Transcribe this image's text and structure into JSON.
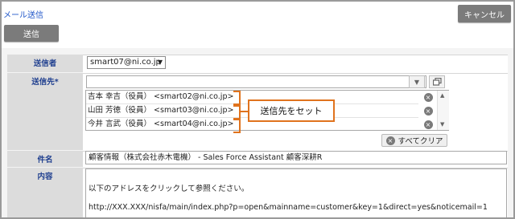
{
  "window": {
    "title": "メール送信"
  },
  "toolbar": {
    "cancel_label": "キャンセル",
    "send_label": "送信"
  },
  "form": {
    "sender_label": "送信者",
    "sender_value": "smart07@ni.co.jp",
    "to_label": "送信先*",
    "to_input_value": "",
    "recipients": [
      {
        "text": "吉本 幸吉（役員） <smart02@ni.co.jp>"
      },
      {
        "text": "山田 芳徳（役員） <smart03@ni.co.jp>"
      },
      {
        "text": "今井 言武（役員） <smart04@ni.co.jp>"
      }
    ],
    "clear_all_label": "すべてクリア",
    "subject_label": "件名",
    "subject_value": "顧客情報（株式会社赤木電機） - Sales Force Assistant 顧客深耕R",
    "body_label": "内容",
    "body_lines": [
      "以下のアドレスをクリックして参照ください。",
      "http://XXX.XXX/nisfa/main/index.php?p=open&mainname=customer&key=1&direct=yes&noticemail=1"
    ]
  },
  "annotation": {
    "callout_text": "送信先をセット",
    "color": "#e0731e"
  },
  "colors": {
    "title": "#1f56c8",
    "label_text": "#1f3f8f",
    "button": "#7b7b7b"
  }
}
